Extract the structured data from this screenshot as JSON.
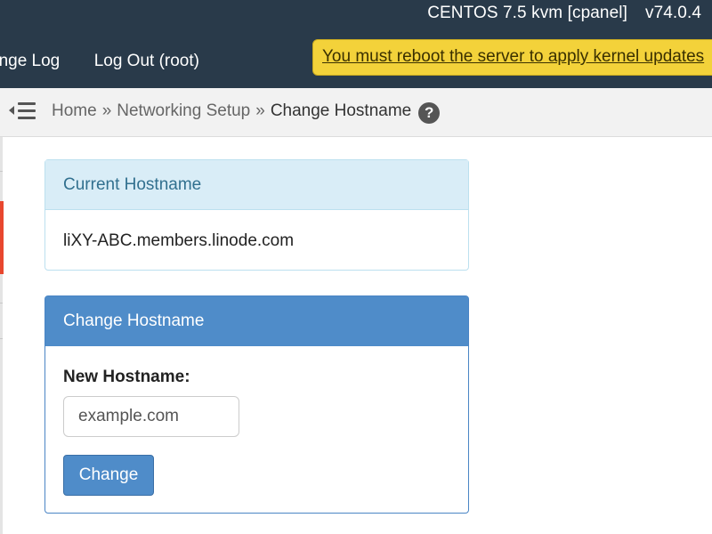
{
  "header": {
    "system_info": "CENTOS 7.5 kvm [cpanel]",
    "version": "v74.0.4",
    "nav": [
      "ange Log",
      "Log Out (root)"
    ],
    "reboot_notice": "You must reboot the server to apply kernel updates"
  },
  "breadcrumb": {
    "items": [
      "Home",
      "Networking Setup"
    ],
    "separator": "»",
    "current": "Change Hostname",
    "help_glyph": "?"
  },
  "current_panel": {
    "title": "Current Hostname",
    "hostname": "liXY-ABC.members.linode.com"
  },
  "change_panel": {
    "title": "Change Hostname",
    "field_label": "New Hostname:",
    "placeholder": "example.com",
    "button_label": "Change"
  },
  "colors": {
    "header_bg": "#293a4a",
    "notice_bg": "#f3d23a",
    "info_header_bg": "#d9edf7",
    "primary_bg": "#4f8cc9",
    "sidebar_active": "#e8472e"
  },
  "icons": {
    "menu_toggle": "collapse-menu-icon",
    "help": "help-circle-icon"
  }
}
